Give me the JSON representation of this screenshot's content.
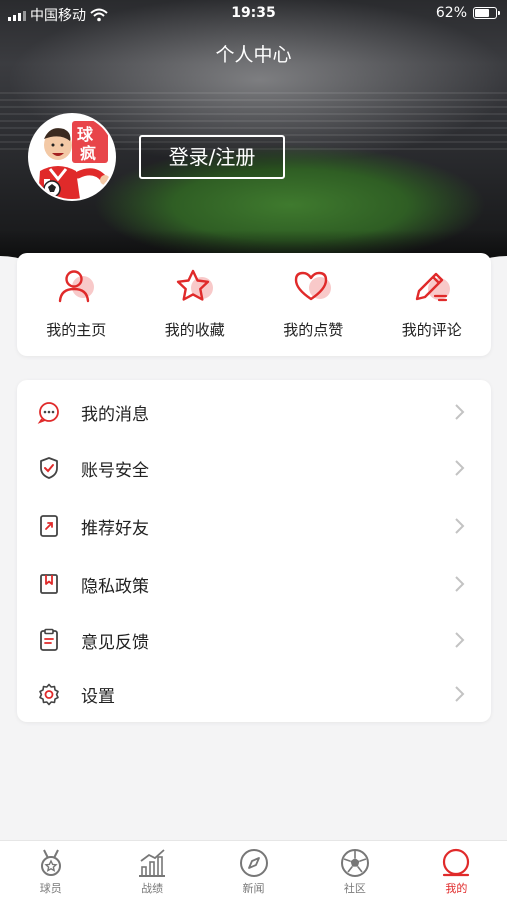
{
  "status_bar": {
    "carrier": "中国移动",
    "time": "19:35",
    "battery": "62%"
  },
  "header": {
    "title": "个人中心",
    "login_label": "登录/注册",
    "avatar_text": "球疯"
  },
  "quick_actions": [
    {
      "label": "我的主页",
      "icon": "user-icon"
    },
    {
      "label": "我的收藏",
      "icon": "star-icon"
    },
    {
      "label": "我的点赞",
      "icon": "heart-icon"
    },
    {
      "label": "我的评论",
      "icon": "pencil-icon"
    }
  ],
  "menu": [
    {
      "label": "我的消息",
      "icon": "message-icon"
    },
    {
      "label": "账号安全",
      "icon": "shield-check-icon"
    },
    {
      "label": "推荐好友",
      "icon": "share-icon"
    },
    {
      "label": "隐私政策",
      "icon": "bookmark-icon"
    },
    {
      "label": "意见反馈",
      "icon": "clipboard-icon"
    },
    {
      "label": "设置",
      "icon": "gear-icon"
    }
  ],
  "tabs": [
    {
      "label": "球员",
      "icon": "medal-icon",
      "active": false
    },
    {
      "label": "战绩",
      "icon": "chart-icon",
      "active": false
    },
    {
      "label": "新闻",
      "icon": "compass-icon",
      "active": false
    },
    {
      "label": "社区",
      "icon": "football-icon",
      "active": false
    },
    {
      "label": "我的",
      "icon": "profile-icon",
      "active": true
    }
  ],
  "colors": {
    "accent": "#e02a2a",
    "accent_soft": "#f8c9c9",
    "background": "#f4f4f5"
  }
}
